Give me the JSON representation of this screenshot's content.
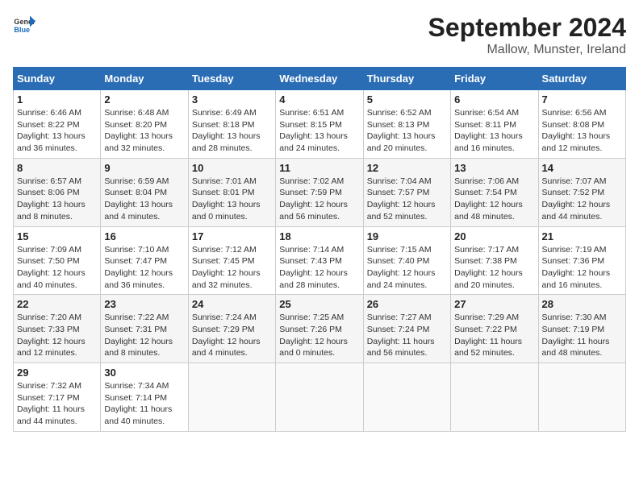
{
  "header": {
    "logo_general": "General",
    "logo_blue": "Blue",
    "month_title": "September 2024",
    "location": "Mallow, Munster, Ireland"
  },
  "calendar": {
    "days_of_week": [
      "Sunday",
      "Monday",
      "Tuesday",
      "Wednesday",
      "Thursday",
      "Friday",
      "Saturday"
    ],
    "weeks": [
      [
        {
          "day": "1",
          "sunrise": "6:46 AM",
          "sunset": "8:22 PM",
          "daylight": "13 hours and 36 minutes."
        },
        {
          "day": "2",
          "sunrise": "6:48 AM",
          "sunset": "8:20 PM",
          "daylight": "13 hours and 32 minutes."
        },
        {
          "day": "3",
          "sunrise": "6:49 AM",
          "sunset": "8:18 PM",
          "daylight": "13 hours and 28 minutes."
        },
        {
          "day": "4",
          "sunrise": "6:51 AM",
          "sunset": "8:15 PM",
          "daylight": "13 hours and 24 minutes."
        },
        {
          "day": "5",
          "sunrise": "6:52 AM",
          "sunset": "8:13 PM",
          "daylight": "13 hours and 20 minutes."
        },
        {
          "day": "6",
          "sunrise": "6:54 AM",
          "sunset": "8:11 PM",
          "daylight": "13 hours and 16 minutes."
        },
        {
          "day": "7",
          "sunrise": "6:56 AM",
          "sunset": "8:08 PM",
          "daylight": "13 hours and 12 minutes."
        }
      ],
      [
        {
          "day": "8",
          "sunrise": "6:57 AM",
          "sunset": "8:06 PM",
          "daylight": "13 hours and 8 minutes."
        },
        {
          "day": "9",
          "sunrise": "6:59 AM",
          "sunset": "8:04 PM",
          "daylight": "13 hours and 4 minutes."
        },
        {
          "day": "10",
          "sunrise": "7:01 AM",
          "sunset": "8:01 PM",
          "daylight": "13 hours and 0 minutes."
        },
        {
          "day": "11",
          "sunrise": "7:02 AM",
          "sunset": "7:59 PM",
          "daylight": "12 hours and 56 minutes."
        },
        {
          "day": "12",
          "sunrise": "7:04 AM",
          "sunset": "7:57 PM",
          "daylight": "12 hours and 52 minutes."
        },
        {
          "day": "13",
          "sunrise": "7:06 AM",
          "sunset": "7:54 PM",
          "daylight": "12 hours and 48 minutes."
        },
        {
          "day": "14",
          "sunrise": "7:07 AM",
          "sunset": "7:52 PM",
          "daylight": "12 hours and 44 minutes."
        }
      ],
      [
        {
          "day": "15",
          "sunrise": "7:09 AM",
          "sunset": "7:50 PM",
          "daylight": "12 hours and 40 minutes."
        },
        {
          "day": "16",
          "sunrise": "7:10 AM",
          "sunset": "7:47 PM",
          "daylight": "12 hours and 36 minutes."
        },
        {
          "day": "17",
          "sunrise": "7:12 AM",
          "sunset": "7:45 PM",
          "daylight": "12 hours and 32 minutes."
        },
        {
          "day": "18",
          "sunrise": "7:14 AM",
          "sunset": "7:43 PM",
          "daylight": "12 hours and 28 minutes."
        },
        {
          "day": "19",
          "sunrise": "7:15 AM",
          "sunset": "7:40 PM",
          "daylight": "12 hours and 24 minutes."
        },
        {
          "day": "20",
          "sunrise": "7:17 AM",
          "sunset": "7:38 PM",
          "daylight": "12 hours and 20 minutes."
        },
        {
          "day": "21",
          "sunrise": "7:19 AM",
          "sunset": "7:36 PM",
          "daylight": "12 hours and 16 minutes."
        }
      ],
      [
        {
          "day": "22",
          "sunrise": "7:20 AM",
          "sunset": "7:33 PM",
          "daylight": "12 hours and 12 minutes."
        },
        {
          "day": "23",
          "sunrise": "7:22 AM",
          "sunset": "7:31 PM",
          "daylight": "12 hours and 8 minutes."
        },
        {
          "day": "24",
          "sunrise": "7:24 AM",
          "sunset": "7:29 PM",
          "daylight": "12 hours and 4 minutes."
        },
        {
          "day": "25",
          "sunrise": "7:25 AM",
          "sunset": "7:26 PM",
          "daylight": "12 hours and 0 minutes."
        },
        {
          "day": "26",
          "sunrise": "7:27 AM",
          "sunset": "7:24 PM",
          "daylight": "11 hours and 56 minutes."
        },
        {
          "day": "27",
          "sunrise": "7:29 AM",
          "sunset": "7:22 PM",
          "daylight": "11 hours and 52 minutes."
        },
        {
          "day": "28",
          "sunrise": "7:30 AM",
          "sunset": "7:19 PM",
          "daylight": "11 hours and 48 minutes."
        }
      ],
      [
        {
          "day": "29",
          "sunrise": "7:32 AM",
          "sunset": "7:17 PM",
          "daylight": "11 hours and 44 minutes."
        },
        {
          "day": "30",
          "sunrise": "7:34 AM",
          "sunset": "7:14 PM",
          "daylight": "11 hours and 40 minutes."
        },
        null,
        null,
        null,
        null,
        null
      ]
    ]
  }
}
